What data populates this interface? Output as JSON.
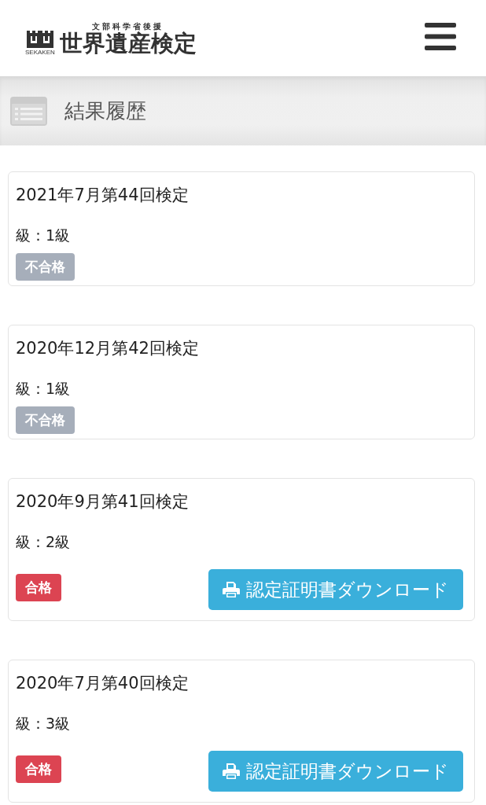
{
  "header": {
    "logo": {
      "supporter": "文部科学省後援",
      "name": "世界遺産検定",
      "mark_caption": "SEKAKEN"
    }
  },
  "page_title": "結果履歴",
  "records": [
    {
      "title": "2021年7月第44回検定",
      "grade": "級：1級",
      "result": {
        "label": "不合格",
        "passed": false
      }
    },
    {
      "title": "2020年12月第42回検定",
      "grade": "級：1級",
      "result": {
        "label": "不合格",
        "passed": false
      }
    },
    {
      "title": "2020年9月第41回検定",
      "grade": "級：2級",
      "result": {
        "label": "合格",
        "passed": true
      },
      "download_button": "認定証明書ダウンロード"
    },
    {
      "title": "2020年7月第40回検定",
      "grade": "級：3級",
      "result": {
        "label": "合格",
        "passed": true
      },
      "download_button": "認定証明書ダウンロード"
    }
  ]
}
